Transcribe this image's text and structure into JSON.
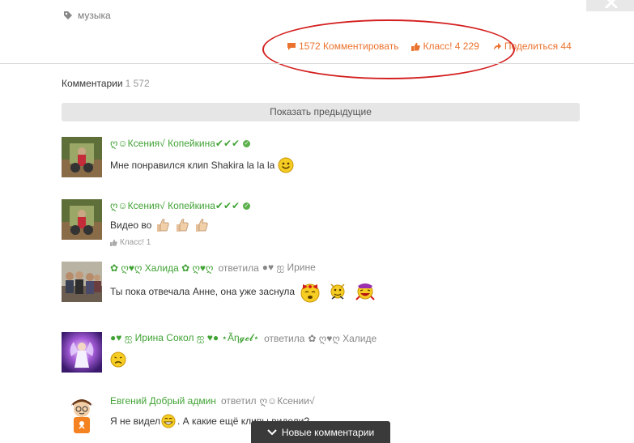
{
  "tag": {
    "label": "музыка",
    "icon": "tag-icon"
  },
  "actions": {
    "comment_label": "1572 Комментировать",
    "like_label": "Класс! 4 229",
    "share_label": "Поделиться 44"
  },
  "comments_section": {
    "title": "Комментарии",
    "count": "1 572",
    "show_previous": "Показать предыдущие",
    "new_comments": "Новые комментарии"
  },
  "comments": [
    {
      "author": "ღ☺Ксения√ Копейкина✔✔✔",
      "text": "Мне понравился клип Shakira la la la"
    },
    {
      "author": "ღ☺Ксения√ Копейкина✔✔✔",
      "text": "Видео во",
      "like": "Класс! 1"
    },
    {
      "author": "✿ ღ♥ღ Халида ✿ ღ♥ღ",
      "reply_word": "ответила",
      "reply_to": "●♥ ஐ Ирине",
      "text": "Ты пока отвечала Анне, она уже заснула"
    },
    {
      "author": "●♥ ஐ Ирина Сокол ஐ ♥● ⋆Ãη𝓰𝓮𝓵⋆",
      "reply_word": "ответила",
      "reply_to": "✿ ღ♥ღ Халиде",
      "text": ""
    },
    {
      "author": "Евгений Добрый админ",
      "reply_word": "ответил",
      "reply_to": "ღ☺Ксении√",
      "text_before": "Я не видел",
      "text_after": ". А какие ещё клипы видели?"
    }
  ],
  "colors": {
    "accent": "#eb722e",
    "author": "#41a335",
    "highlight": "#d42020"
  }
}
